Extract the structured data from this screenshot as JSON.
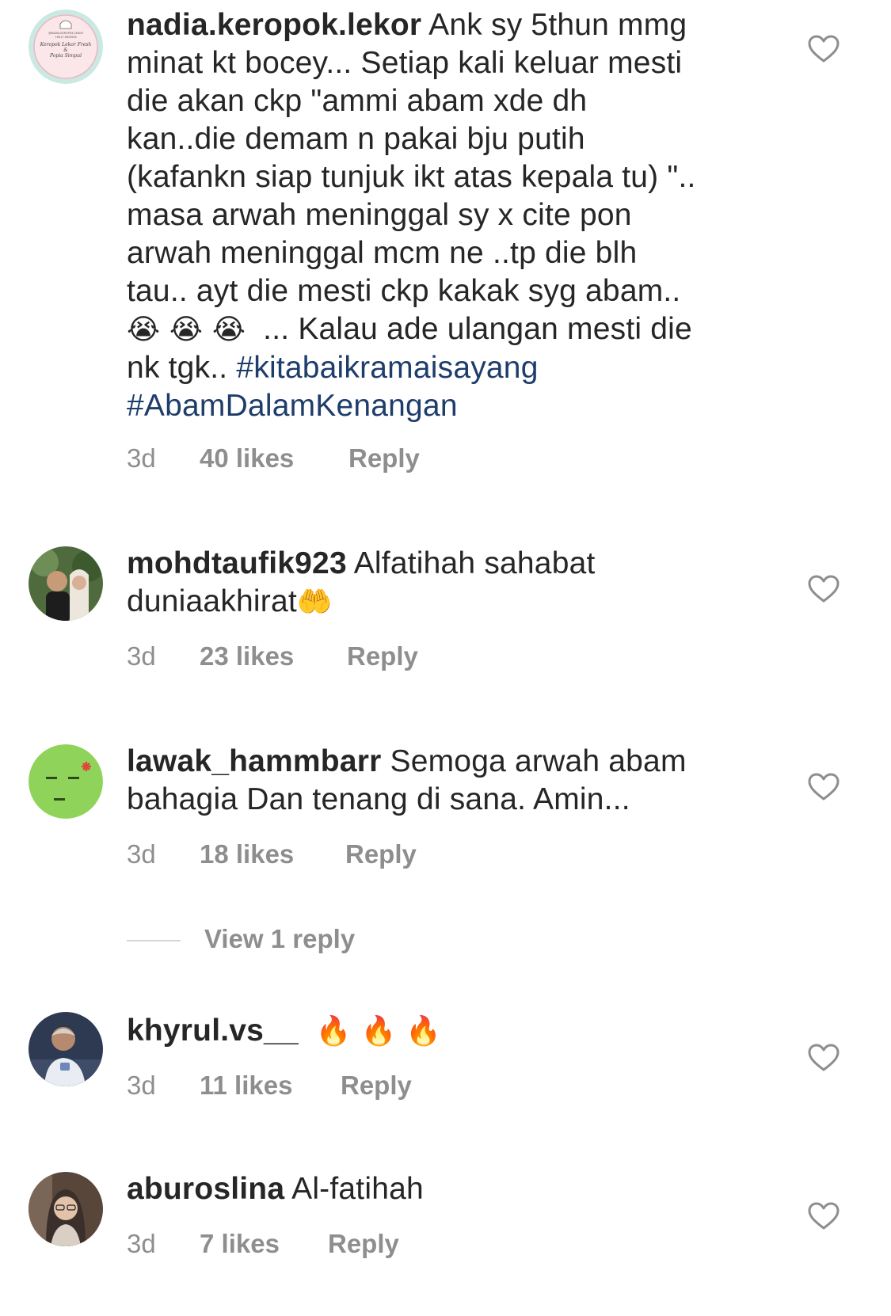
{
  "comments": [
    {
      "username": "nadia.keropok.lekor",
      "lines": [
        "Ank sy 5thun mmg",
        "minat kt bocey... Setiap kali keluar mesti",
        "die akan ckp \"ammi abam xde dh",
        "kan..die demam n pakai bju putih",
        "(kafankn siap tunjuk ikt atas kepala tu) \"..",
        "masa arwah meninggal sy x cite pon",
        "arwah meninggal mcm ne ..tp die blh",
        "tau.. ayt die mesti ckp kakak syg abam..",
        "... Kalau ade ulangan mesti die",
        "nk tgk.."
      ],
      "emojis": "😭 😭 😭",
      "hashtags": [
        "#kitabaikramaisayang",
        "#AbamDalamKenangan"
      ],
      "avatar_text": [
        "@NADIA.KEROPOK.LEKOR",
        "+6017-9625692",
        "Keropok Lekor Fresh",
        "&",
        "Popia Simpul"
      ],
      "time": "3d",
      "likes": "40 likes",
      "reply": "Reply"
    },
    {
      "username": "mohdtaufik923",
      "lines": [
        "Alfatihah sahabat",
        "duniaakhirat"
      ],
      "emojis": "🤲",
      "time": "3d",
      "likes": "23 likes",
      "reply": "Reply"
    },
    {
      "username": "lawak_hammbarr",
      "lines": [
        "Semoga arwah abam",
        "bahagia Dan tenang di sana. Amin..."
      ],
      "time": "3d",
      "likes": "18 likes",
      "reply": "Reply"
    },
    {
      "username": "khyrul.vs__",
      "emojis": "🔥 🔥 🔥",
      "time": "3d",
      "likes": "11 likes",
      "reply": "Reply"
    },
    {
      "username": "aburoslina",
      "lines": [
        "Al-fatihah"
      ],
      "time": "3d",
      "likes": "7 likes",
      "reply": "Reply"
    }
  ],
  "view_replies": "View 1 reply",
  "colors": {
    "text": "#262626",
    "meta": "#8e8e8e",
    "hashtag": "#1e3d6b",
    "heart_stroke": "#8e8e8e",
    "avatar_green": "#8fd35a"
  },
  "icons": {
    "like": "heart-outline-icon"
  }
}
